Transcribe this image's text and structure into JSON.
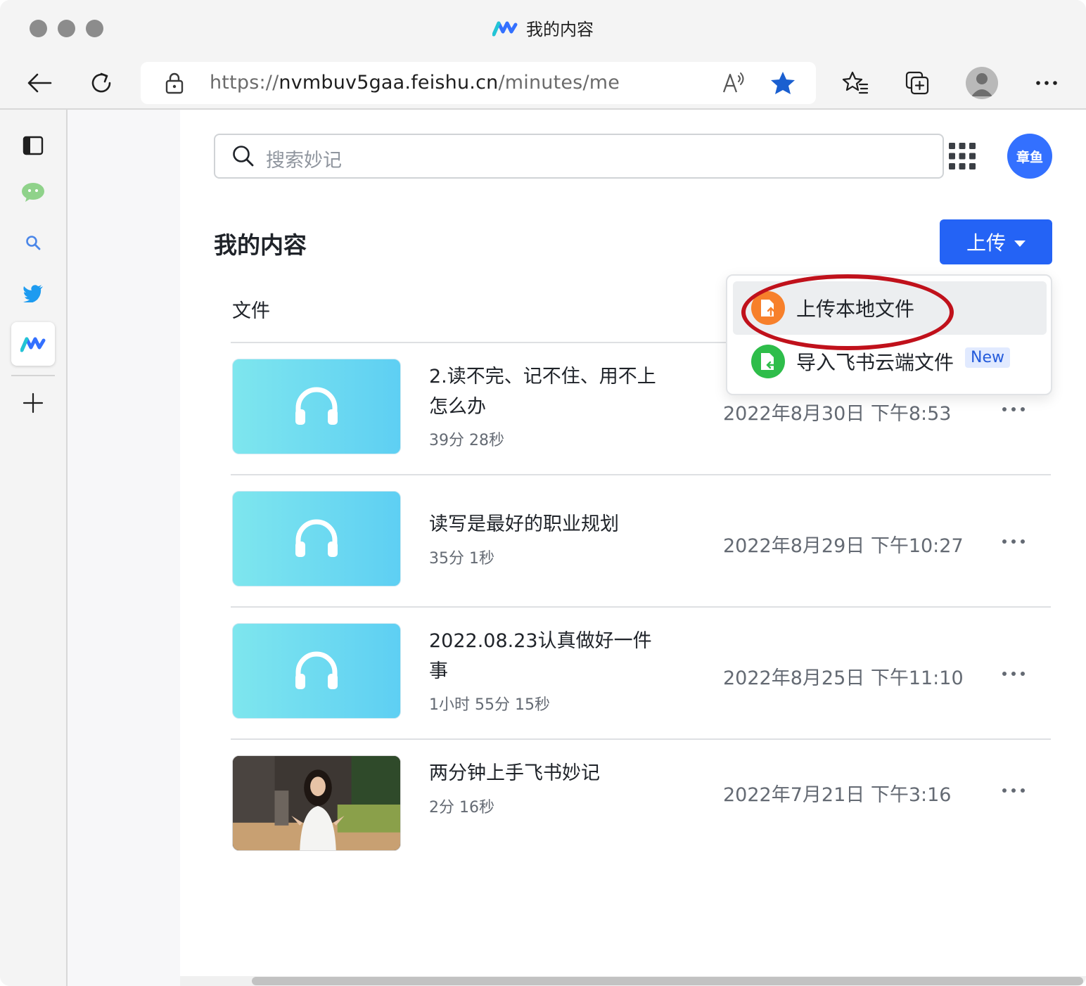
{
  "window": {
    "title": "我的内容"
  },
  "browser": {
    "url_scheme": "https://",
    "url_host": "nvmbuv5gaa.feishu.cn",
    "url_path": "/minutes/me"
  },
  "search": {
    "placeholder": "搜索妙记"
  },
  "user": {
    "avatar_text": "章鱼"
  },
  "page": {
    "title": "我的内容",
    "upload_label": "上传",
    "column_file": "文件"
  },
  "upload_menu": {
    "items": [
      {
        "label": "上传本地文件",
        "icon": "upload-file-icon",
        "color": "#f7802b"
      },
      {
        "label": "导入飞书云端文件",
        "icon": "import-cloud-file-icon",
        "color": "#2ebd4a",
        "badge": "New"
      }
    ]
  },
  "files": [
    {
      "title": "2.读不完、记不住、用不上怎么办",
      "duration": "39分 28秒",
      "date": "2022年8月30日 下午8:53",
      "thumb": "headphones-icon"
    },
    {
      "title": "读写是最好的职业规划",
      "duration": "35分 1秒",
      "date": "2022年8月29日 下午10:27",
      "thumb": "headphones-icon"
    },
    {
      "title": "2022.08.23认真做好一件事",
      "duration": "1小时 55分 15秒",
      "date": "2022年8月25日 下午11:10",
      "thumb": "headphones-icon"
    },
    {
      "title": "两分钟上手飞书妙记",
      "duration": "2分 16秒",
      "date": "2022年7月21日 下午3:16",
      "thumb": "video-thumbnail"
    }
  ],
  "colors": {
    "primary": "#2463f5",
    "thumb_start": "#7ee6ee",
    "thumb_end": "#5ecff3",
    "highlight_ring": "#c0111b"
  }
}
